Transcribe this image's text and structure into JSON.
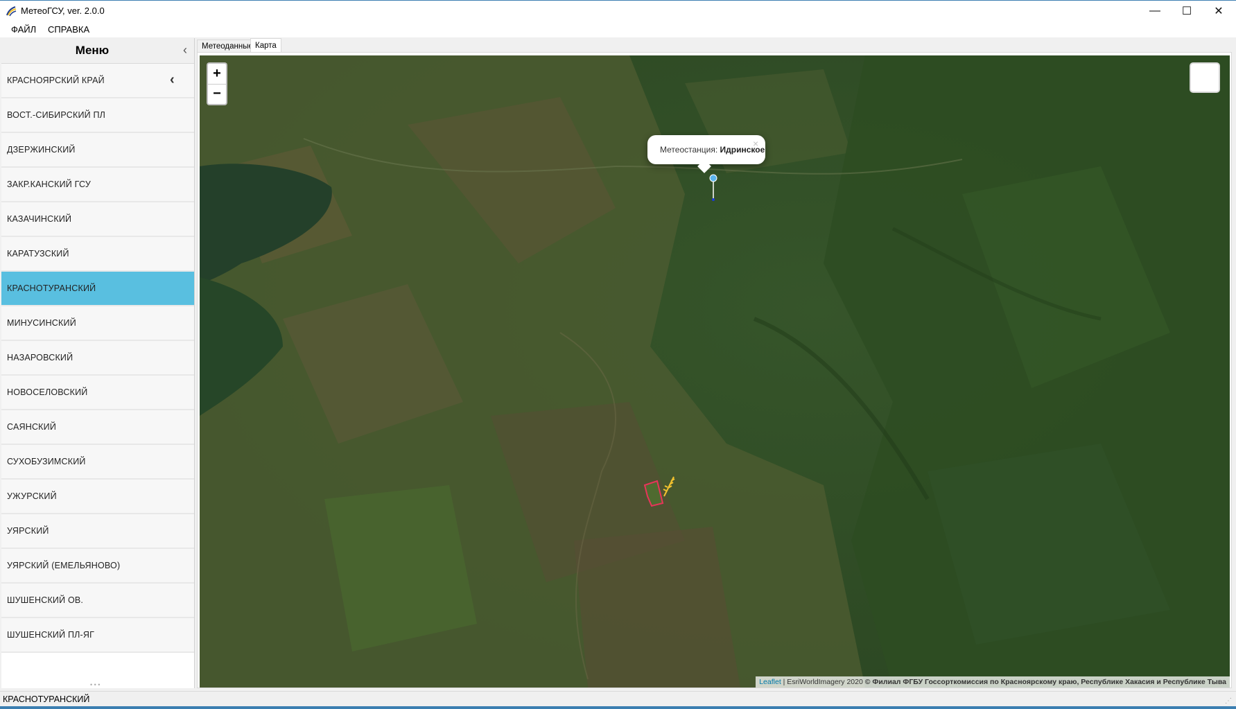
{
  "window": {
    "title": "МетеоГСУ, ver. 2.0.0",
    "app_icon": "wheat-logo-icon",
    "controls": {
      "minimize": "—",
      "maximize": "☐",
      "close": "✕"
    }
  },
  "menubar": {
    "file": "ФАЙЛ",
    "help": "СПРАВКА"
  },
  "sidebar": {
    "title": "Меню",
    "collapse_icon": "‹",
    "items": [
      {
        "label": "КРАСНОЯРСКИЙ КРАЙ"
      },
      {
        "label": "ВОСТ.-СИБИРСКИЙ ПЛ"
      },
      {
        "label": "ДЗЕРЖИНСКИЙ"
      },
      {
        "label": "ЗАКР.КАНСКИЙ ГСУ"
      },
      {
        "label": "КАЗАЧИНСКИЙ"
      },
      {
        "label": "КАРАТУЗСКИЙ"
      },
      {
        "label": "КРАСНОТУРАНСКИЙ",
        "selected": true
      },
      {
        "label": "МИНУСИНСКИЙ"
      },
      {
        "label": "НАЗАРОВСКИЙ"
      },
      {
        "label": "НОВОСЕЛОВСКИЙ"
      },
      {
        "label": "САЯНСКИЙ"
      },
      {
        "label": "СУХОБУЗИМСКИЙ"
      },
      {
        "label": "УЖУРСКИЙ"
      },
      {
        "label": "УЯРСКИЙ"
      },
      {
        "label": "УЯРСКИЙ (ЕМЕЛЬЯНОВО)"
      },
      {
        "label": "ШУШЕНСКИЙ ОВ."
      },
      {
        "label": "ШУШЕНСКИЙ ПЛ-ЯГ"
      }
    ],
    "back_chevron": "‹"
  },
  "tabs": [
    {
      "label": "Метеоданные",
      "active": false
    },
    {
      "label": "Карта",
      "active": true
    }
  ],
  "map": {
    "zoom_in": "+",
    "zoom_out": "−",
    "popup": {
      "prefix": "Метеостанция: ",
      "station": "Идринское",
      "close": "×"
    },
    "attribution": {
      "leaflet": "Leaflet",
      "separator": " | EsriWorldImagery 2020 ",
      "owner": "© Филиал ФГБУ Госсорткомиссия по Красноярскому краю, Республике Хакасия и Республике Тыва"
    },
    "colors": {
      "forest": "#2f4d22",
      "field": "#4f6a30",
      "water": "#29452a",
      "field_outline": "#e8345a",
      "marker": "#2f8fd8"
    }
  },
  "status": {
    "text": "КРАСНОТУРАНСКИЙ"
  }
}
